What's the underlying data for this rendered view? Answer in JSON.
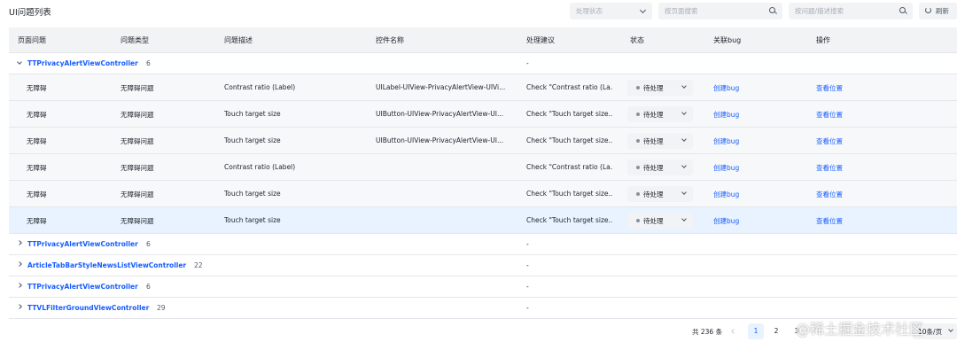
{
  "header": {
    "title": "UI问题列表",
    "status_filter_placeholder": "处理状态",
    "page_search_placeholder": "按页面搜索",
    "desc_search_placeholder": "按问题/描述搜索",
    "refresh_label": "刷新"
  },
  "table": {
    "columns": [
      "页面问题",
      "问题类型",
      "问题描述",
      "控件名称",
      "处理建议",
      "状态",
      "关联bug",
      "操作"
    ],
    "groups": [
      {
        "name": "TTPrivacyAlertViewController",
        "count": "6",
        "suggestion": "-",
        "expanded": true,
        "rows": [
          {
            "page": "无障碍",
            "type": "无障碍问题",
            "desc": "Contrast ratio (Label)",
            "control": "UILabel-UIView-PrivacyAlertView-UIVi...",
            "suggest": "Check \"Contrast ratio (La...",
            "status": "待处理",
            "bug": "创建bug",
            "action": "查看位置"
          },
          {
            "page": "无障碍",
            "type": "无障碍问题",
            "desc": "Touch target size",
            "control": "UIButton-UIView-PrivacyAlertView-UI...",
            "suggest": "Check \"Touch target size...",
            "status": "待处理",
            "bug": "创建bug",
            "action": "查看位置"
          },
          {
            "page": "无障碍",
            "type": "无障碍问题",
            "desc": "Touch target size",
            "control": "UIButton-UIView-PrivacyAlertView-UI...",
            "suggest": "Check \"Touch target size...",
            "status": "待处理",
            "bug": "创建bug",
            "action": "查看位置"
          },
          {
            "page": "无障碍",
            "type": "无障碍问题",
            "desc": "Contrast ratio (Label)",
            "control": "",
            "suggest": "Check \"Contrast ratio (La...",
            "status": "待处理",
            "bug": "创建bug",
            "action": "查看位置"
          },
          {
            "page": "无障碍",
            "type": "无障碍问题",
            "desc": "Touch target size",
            "control": "",
            "suggest": "Check \"Touch target size...",
            "status": "待处理",
            "bug": "创建bug",
            "action": "查看位置"
          },
          {
            "page": "无障碍",
            "type": "无障碍问题",
            "desc": "Touch target size",
            "control": "",
            "suggest": "Check \"Touch target size...",
            "status": "待处理",
            "bug": "创建bug",
            "action": "查看位置"
          }
        ]
      },
      {
        "name": "TTPrivacyAlertViewController",
        "count": "6",
        "suggestion": "-",
        "expanded": false,
        "rows": []
      },
      {
        "name": "ArticleTabBarStyleNewsListViewController",
        "count": "22",
        "suggestion": "-",
        "expanded": false,
        "rows": []
      },
      {
        "name": "TTPrivacyAlertViewController",
        "count": "6",
        "suggestion": "-",
        "expanded": false,
        "rows": []
      },
      {
        "name": "TTVLFilterGroundViewController",
        "count": "29",
        "suggestion": "-",
        "expanded": false,
        "rows": []
      }
    ]
  },
  "pagination": {
    "total": "共 236 条",
    "pages": [
      "1",
      "2",
      "3"
    ],
    "current_page": "1",
    "page_size": "10条/页"
  },
  "watermark": "@稀土掘金技术社区",
  "colors": {
    "link": "#165dff",
    "header_bg": "#f2f3f5",
    "highlight_row": "#e8f3ff"
  }
}
